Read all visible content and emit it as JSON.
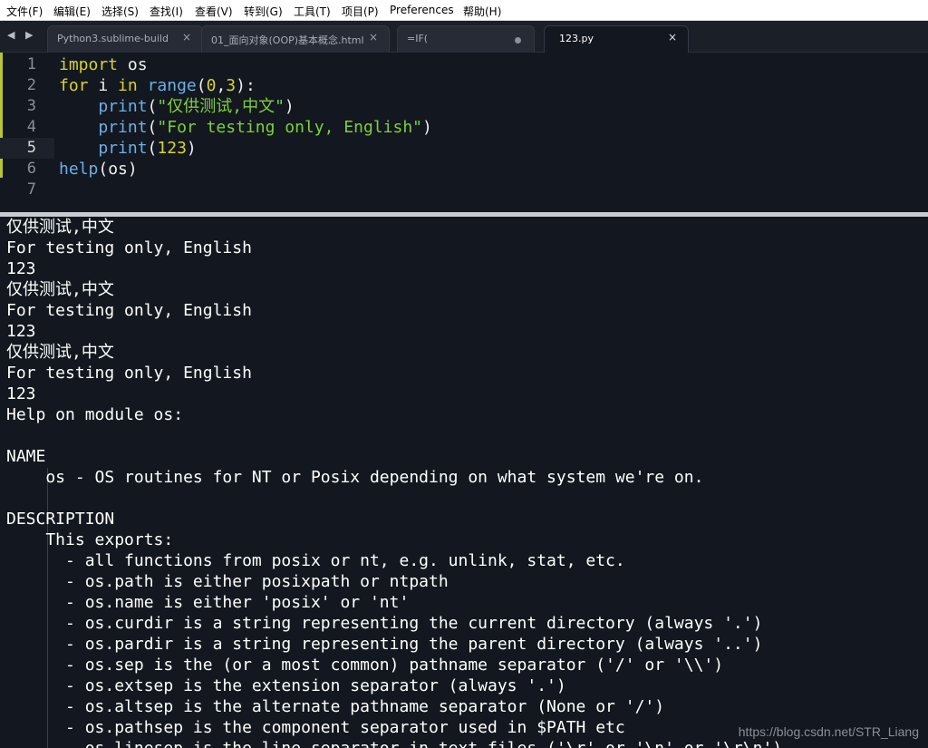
{
  "menubar": {
    "items": [
      "文件(F)",
      "编辑(E)",
      "选择(S)",
      "查找(I)",
      "查看(V)",
      "转到(G)",
      "工具(T)",
      "项目(P)",
      "Preferences",
      "帮助(H)"
    ]
  },
  "tabs": [
    {
      "label": "Python3.sublime-build",
      "close": "×"
    },
    {
      "label": "01_面向对象(OOP)基本概念.html",
      "close": "×"
    },
    {
      "label": "=IF(",
      "close": ""
    },
    {
      "label": "123.py",
      "close": "×"
    }
  ],
  "nav_arrows": "◀ ▶",
  "editor": {
    "line_numbers": [
      "1",
      "2",
      "3",
      "4",
      "5",
      "6",
      "7"
    ],
    "lines": [
      [
        {
          "t": "import",
          "c": "kw"
        },
        {
          "t": " os",
          "c": ""
        }
      ],
      [
        {
          "t": "for",
          "c": "kw"
        },
        {
          "t": " i ",
          "c": ""
        },
        {
          "t": "in",
          "c": "kw"
        },
        {
          "t": " ",
          "c": ""
        },
        {
          "t": "range",
          "c": "fn"
        },
        {
          "t": "(",
          "c": ""
        },
        {
          "t": "0",
          "c": "num"
        },
        {
          "t": ",",
          "c": ""
        },
        {
          "t": "3",
          "c": "num"
        },
        {
          "t": "):",
          "c": ""
        }
      ],
      [
        {
          "t": "    ",
          "c": ""
        },
        {
          "t": "print",
          "c": "fn"
        },
        {
          "t": "(",
          "c": ""
        },
        {
          "t": "\"仅供测试,中文\"",
          "c": "str"
        },
        {
          "t": ")",
          "c": ""
        }
      ],
      [
        {
          "t": "    ",
          "c": ""
        },
        {
          "t": "print",
          "c": "fn"
        },
        {
          "t": "(",
          "c": ""
        },
        {
          "t": "\"For testing only, English\"",
          "c": "str"
        },
        {
          "t": ")",
          "c": ""
        }
      ],
      [
        {
          "t": "    ",
          "c": ""
        },
        {
          "t": "print",
          "c": "fn"
        },
        {
          "t": "(",
          "c": ""
        },
        {
          "t": "123",
          "c": "num"
        },
        {
          "t": ")",
          "c": ""
        }
      ],
      [
        {
          "t": "help",
          "c": "fn"
        },
        {
          "t": "(os)",
          "c": ""
        }
      ],
      []
    ]
  },
  "output": {
    "lines": [
      "仅供测试,中文",
      "For testing only, English",
      "123",
      "仅供测试,中文",
      "For testing only, English",
      "123",
      "仅供测试,中文",
      "For testing only, English",
      "123",
      "Help on module os:",
      "",
      "NAME",
      "    os - OS routines for NT or Posix depending on what system we're on.",
      "",
      "DESCRIPTION",
      "    This exports:",
      "      - all functions from posix or nt, e.g. unlink, stat, etc.",
      "      - os.path is either posixpath or ntpath",
      "      - os.name is either 'posix' or 'nt'",
      "      - os.curdir is a string representing the current directory (always '.')",
      "      - os.pardir is a string representing the parent directory (always '..')",
      "      - os.sep is the (or a most common) pathname separator ('/' or '\\\\')",
      "      - os.extsep is the extension separator (always '.')",
      "      - os.altsep is the alternate pathname separator (None or '/')",
      "      - os.pathsep is the component separator used in $PATH etc",
      "      - os.linesep is the line separator in text files ('\\r' or '\\n' or '\\r\\n')"
    ]
  },
  "watermark": "https://blog.csdn.net/STR_Liang"
}
